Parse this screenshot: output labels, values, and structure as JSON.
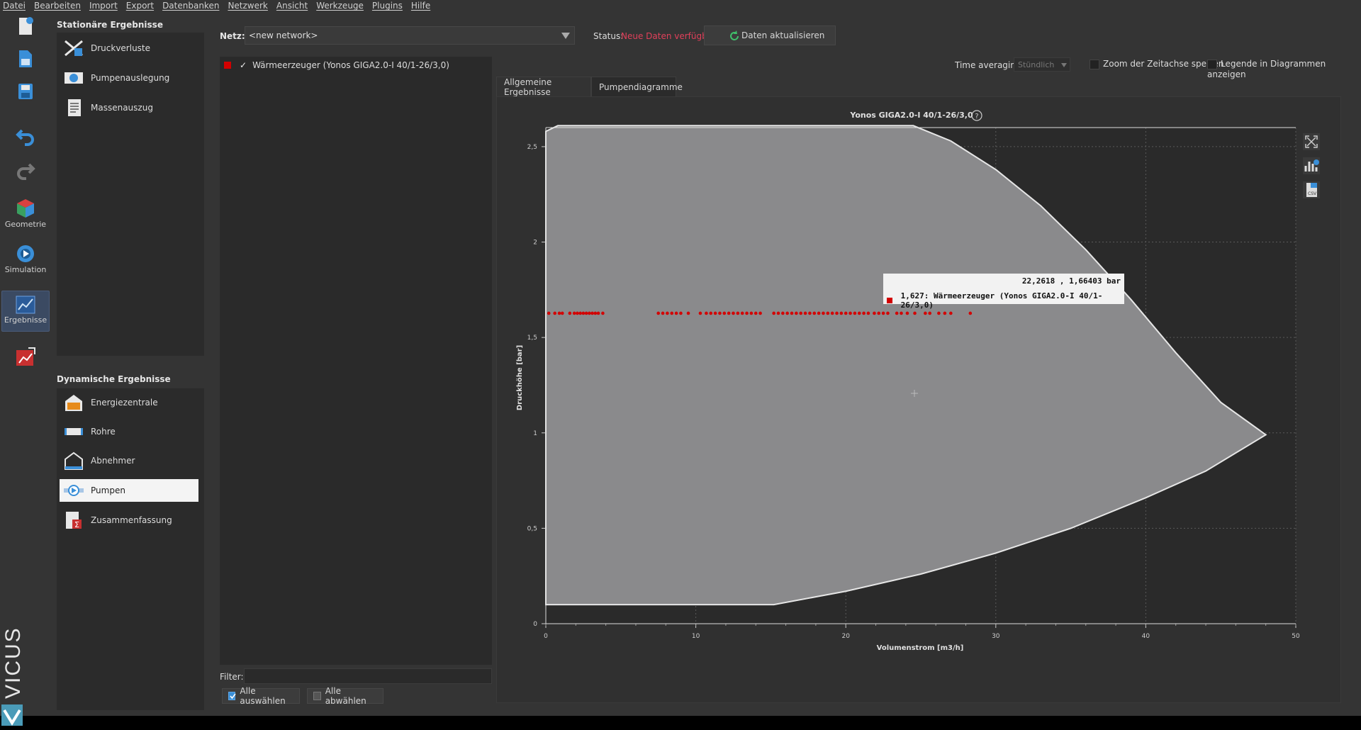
{
  "menu": [
    "Datei",
    "Bearbeiten",
    "Import",
    "Export",
    "Datenbanken",
    "Netzwerk",
    "Ansicht",
    "Werkzeuge",
    "Plugins",
    "Hilfe"
  ],
  "toolbar": {
    "geometry": "Geometrie",
    "simulation": "Simulation",
    "results": "Ergebnisse",
    "brand": "VICUS"
  },
  "stationary": {
    "title": "Stationäre Ergebnisse",
    "items": [
      "Druckverluste",
      "Pumpenauslegung",
      "Massenauszug"
    ]
  },
  "dynamic": {
    "title": "Dynamische Ergebnisse",
    "items": [
      "Energiezentrale",
      "Rohre",
      "Abnehmer",
      "Pumpen",
      "Zusammenfassung"
    ],
    "selected": "Pumpen"
  },
  "network": {
    "label": "Netz:",
    "value": "<new network>"
  },
  "status": {
    "label": "Status:",
    "value": "Neue Daten verfügbar",
    "value_color": "#e0405a",
    "refresh": "Daten aktualisieren"
  },
  "list": {
    "items": [
      {
        "label": "Wärmeerzeuger (Yonos GIGA2.0-I 40/1-26/3,0)",
        "checked": "✓",
        "color": "#d30000"
      }
    ]
  },
  "filter": {
    "label": "Filter:",
    "value": ""
  },
  "buttons": {
    "select_all": "Alle auswählen",
    "deselect_all": "Alle abwählen"
  },
  "options": {
    "time_avg_label": "Time averaging",
    "time_avg_value": "Stündlich",
    "zoom_lock": "Zoom der Zeitachse sperren",
    "legend_show": "Legende in Diagrammen anzeigen"
  },
  "tabs": [
    "Allgemeine Ergebnisse",
    "Pumpendiagramme"
  ],
  "active_tab": "Pumpendiagramme",
  "tooltip": {
    "coords": "22,2618 , 1,66403 bar",
    "entry": "1,627: Wärmeerzeuger (Yonos GIGA2.0-I 40/1-26/3,0)"
  },
  "chart_data": {
    "type": "area",
    "title": "Yonos GIGA2.0-I 40/1-26/3,0",
    "xlabel": "Volumenstrom [m3/h]",
    "ylabel": "Druckhöhe [bar]",
    "xlim": [
      0,
      50
    ],
    "ylim": [
      0,
      2.6
    ],
    "xticks": [
      "0",
      "10",
      "20",
      "30",
      "40",
      "50"
    ],
    "yticks": [
      "0",
      "0,5",
      "1",
      "1,5",
      "2",
      "2,5"
    ],
    "xtick_values": [
      0,
      10,
      20,
      30,
      40,
      50
    ],
    "ytick_values": [
      0,
      0.5,
      1,
      1.5,
      2,
      2.5
    ],
    "grid": true,
    "envelope": {
      "upper": [
        [
          0,
          2.58
        ],
        [
          0.8,
          2.61
        ],
        [
          24.5,
          2.61
        ],
        [
          27,
          2.53
        ],
        [
          30,
          2.38
        ],
        [
          33,
          2.19
        ],
        [
          36,
          1.96
        ],
        [
          39,
          1.7
        ],
        [
          42,
          1.42
        ],
        [
          45,
          1.16
        ],
        [
          48,
          0.99
        ]
      ],
      "lower": [
        [
          0,
          0.1
        ],
        [
          15.2,
          0.1
        ],
        [
          20,
          0.17
        ],
        [
          25,
          0.26
        ],
        [
          30,
          0.37
        ],
        [
          35,
          0.5
        ],
        [
          40,
          0.66
        ],
        [
          44,
          0.8
        ],
        [
          48,
          0.99
        ]
      ]
    },
    "series": [
      {
        "name": "Wärmeerzeuger (Yonos GIGA2.0-I 40/1-26/3,0)",
        "color": "#d30000",
        "y": 1.627,
        "x": [
          0.2,
          0.6,
          0.9,
          1.1,
          1.6,
          1.9,
          2.1,
          2.3,
          2.5,
          2.7,
          2.9,
          3.1,
          3.3,
          3.5,
          3.8,
          7.5,
          7.8,
          8.1,
          8.4,
          8.7,
          9.0,
          9.5,
          10.3,
          10.7,
          11.0,
          11.3,
          11.6,
          11.9,
          12.2,
          12.5,
          12.8,
          13.1,
          13.4,
          13.7,
          14.0,
          14.3,
          15.2,
          15.5,
          15.8,
          16.1,
          16.4,
          16.7,
          17.0,
          17.3,
          17.6,
          17.9,
          18.2,
          18.5,
          18.8,
          19.1,
          19.4,
          19.7,
          20.0,
          20.3,
          20.6,
          20.9,
          21.2,
          21.5,
          21.9,
          22.2,
          22.5,
          22.8,
          23.4,
          23.7,
          24.1,
          24.6,
          25.3,
          25.6,
          26.2,
          26.6,
          27.0,
          28.3
        ]
      }
    ]
  }
}
